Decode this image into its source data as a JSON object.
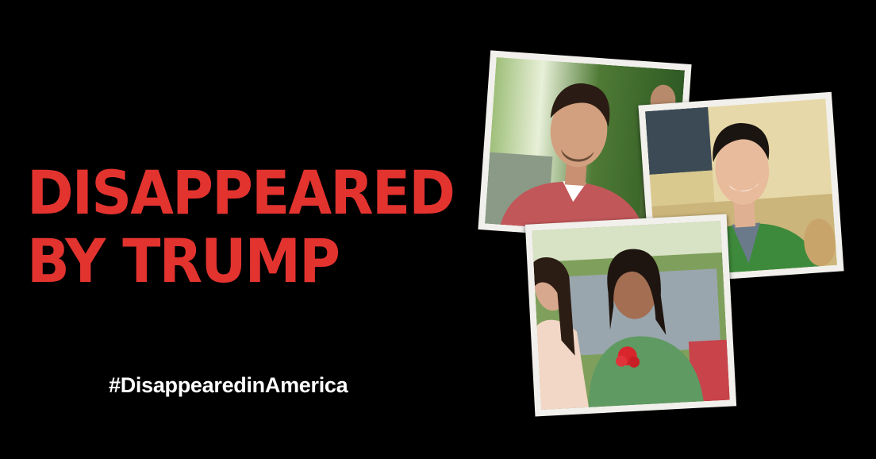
{
  "headline": {
    "line1": "DISAPPEARED",
    "line2": "BY TRUMP"
  },
  "hashtag": "#DisappearedinAmerica",
  "colors": {
    "background": "#000000",
    "headline": "#e3332f",
    "hashtag": "#ffffff",
    "photo_border": "#f2f0ec"
  },
  "photos": [
    {
      "subject": "man-in-red-polo"
    },
    {
      "subject": "man-in-green-vest"
    },
    {
      "subject": "two-women"
    }
  ]
}
